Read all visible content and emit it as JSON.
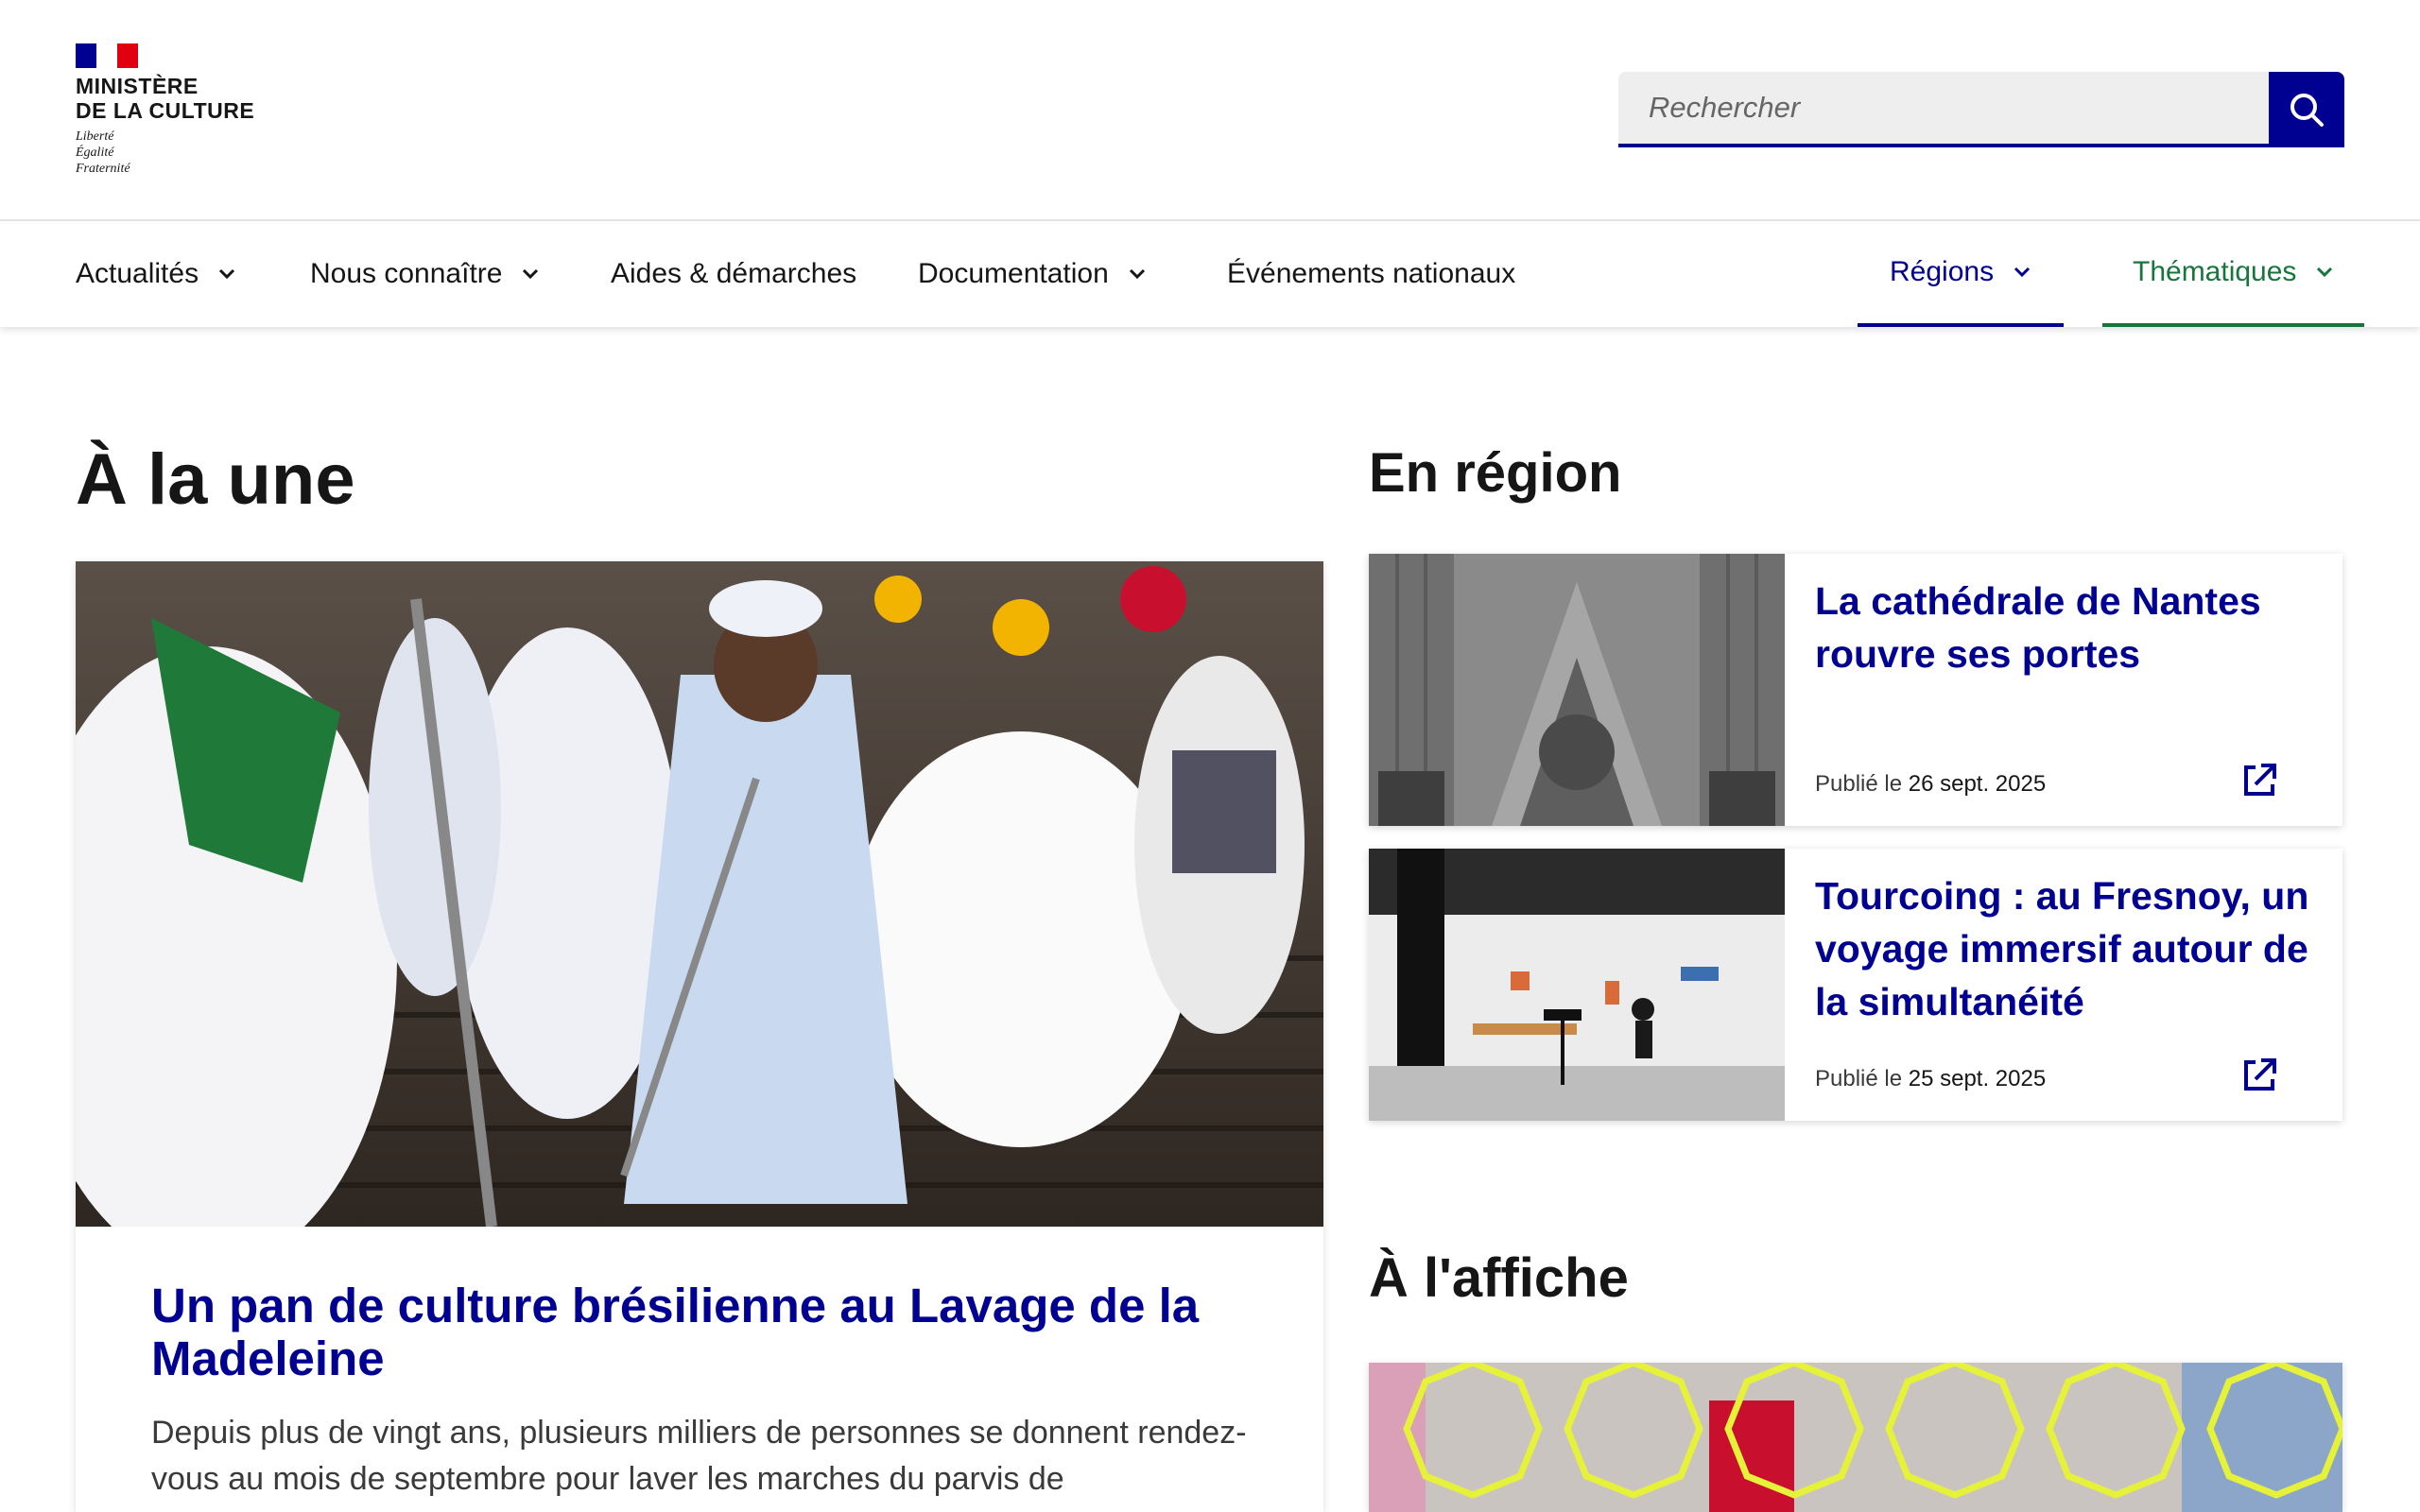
{
  "brand": {
    "line1": "MINISTÈRE",
    "line2": "DE LA CULTURE",
    "motto": [
      "Liberté",
      "Égalité",
      "Fraternité"
    ],
    "colors": {
      "blue": "#000091",
      "red": "#e1000f",
      "green": "#18753c"
    }
  },
  "search": {
    "placeholder": "Rechercher",
    "icon": "search-icon"
  },
  "nav": {
    "items": [
      {
        "label": "Actualités",
        "has_dropdown": true
      },
      {
        "label": "Nous connaître",
        "has_dropdown": true
      },
      {
        "label": "Aides & démarches",
        "has_dropdown": false
      },
      {
        "label": "Documentation",
        "has_dropdown": true
      },
      {
        "label": "Événements nationaux",
        "has_dropdown": false
      }
    ],
    "regions": "Régions",
    "thematiques": "Thématiques"
  },
  "une": {
    "heading": "À la une",
    "title": "Un pan de culture brésilienne au Lavage de la Madeleine",
    "description": "Depuis plus de vingt ans, plusieurs milliers de personnes se donnent rendez-vous au mois de septembre pour laver les marches du parvis de"
  },
  "region": {
    "heading": "En région",
    "cards": [
      {
        "title": "La cathédrale de Nantes rouvre ses portes",
        "published_prefix": "Publié le",
        "date": "26 sept. 2025",
        "icon": "external-link-icon"
      },
      {
        "title": "Tourcoing : au Fresnoy, un voyage immersif autour de la simultanéité",
        "published_prefix": "Publié le",
        "date": "25 sept. 2025",
        "icon": "external-link-icon"
      }
    ]
  },
  "affiche": {
    "heading": "À l'affiche"
  }
}
